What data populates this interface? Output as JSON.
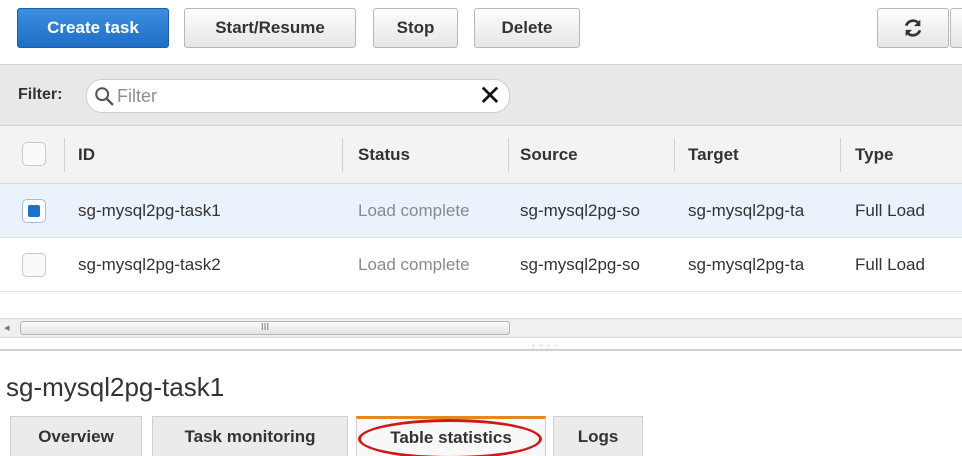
{
  "toolbar": {
    "create_label": "Create task",
    "start_label": "Start/Resume",
    "stop_label": "Stop",
    "delete_label": "Delete",
    "refresh_icon": "refresh-icon",
    "primary_color": "#2a7fd4"
  },
  "filter": {
    "label": "Filter:",
    "placeholder": "Filter",
    "value": "",
    "search_icon": "search-icon",
    "clear_icon": "close-icon"
  },
  "table": {
    "columns": [
      "ID",
      "Status",
      "Source",
      "Target",
      "Type"
    ],
    "rows": [
      {
        "selected": true,
        "id": "sg-mysql2pg-task1",
        "status": "Load complete",
        "source": "sg-mysql2pg-so",
        "target": "sg-mysql2pg-ta",
        "type": "Full Load"
      },
      {
        "selected": false,
        "id": "sg-mysql2pg-task2",
        "status": "Load complete",
        "source": "sg-mysql2pg-so",
        "target": "sg-mysql2pg-ta",
        "type": "Full Load"
      }
    ]
  },
  "scrollbar": {
    "grip": "III",
    "arrow": "◂"
  },
  "details": {
    "title": "sg-mysql2pg-task1",
    "tabs": [
      "Overview",
      "Task monitoring",
      "Table statistics",
      "Logs"
    ],
    "active_tab": "Table statistics",
    "active_accent": "#e8861e",
    "annotation_color": "#d01818"
  }
}
